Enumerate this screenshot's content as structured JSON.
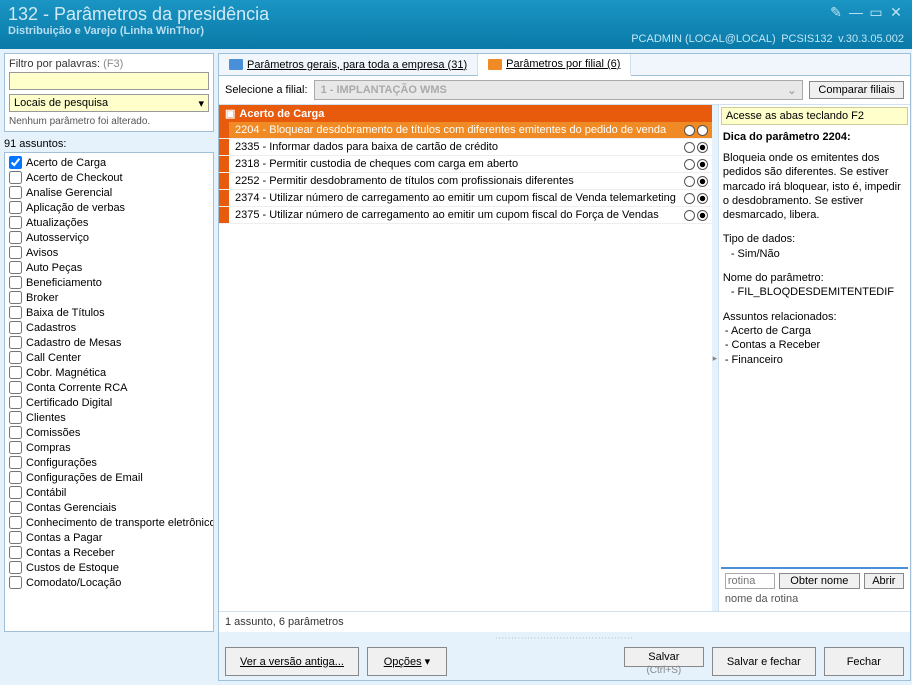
{
  "titlebar": {
    "title": "132 - Parâmetros da presidência",
    "subtitle": "Distribuição e Varejo (Linha WinThor)",
    "user": "PCADMIN (LOCAL@LOCAL)",
    "module": "PCSIS132",
    "version": "v.30.3.05.002"
  },
  "filter": {
    "label": "Filtro por palavras:",
    "hint": "(F3)",
    "search_value": "",
    "dropdown": "Locais de pesquisa",
    "no_change": "Nenhum parâmetro foi alterado."
  },
  "subjects": {
    "count_label": "91 assuntos:",
    "items": [
      {
        "label": "Acerto de Carga",
        "checked": true
      },
      {
        "label": "Acerto de Checkout",
        "checked": false
      },
      {
        "label": "Analise Gerencial",
        "checked": false
      },
      {
        "label": "Aplicação de verbas",
        "checked": false
      },
      {
        "label": "Atualizações",
        "checked": false
      },
      {
        "label": "Autosserviço",
        "checked": false
      },
      {
        "label": "Avisos",
        "checked": false
      },
      {
        "label": "Auto Peças",
        "checked": false
      },
      {
        "label": "Beneficiamento",
        "checked": false
      },
      {
        "label": "Broker",
        "checked": false
      },
      {
        "label": "Baixa de Títulos",
        "checked": false
      },
      {
        "label": "Cadastros",
        "checked": false
      },
      {
        "label": "Cadastro de Mesas",
        "checked": false
      },
      {
        "label": "Call Center",
        "checked": false
      },
      {
        "label": "Cobr. Magnética",
        "checked": false
      },
      {
        "label": "Conta Corrente RCA",
        "checked": false
      },
      {
        "label": "Certificado Digital",
        "checked": false
      },
      {
        "label": "Clientes",
        "checked": false
      },
      {
        "label": "Comissões",
        "checked": false
      },
      {
        "label": "Compras",
        "checked": false
      },
      {
        "label": "Configurações",
        "checked": false
      },
      {
        "label": "Configurações de Email",
        "checked": false
      },
      {
        "label": "Contábil",
        "checked": false
      },
      {
        "label": "Contas Gerenciais",
        "checked": false
      },
      {
        "label": "Conhecimento de transporte eletrônico",
        "checked": false
      },
      {
        "label": "Contas a Pagar",
        "checked": false
      },
      {
        "label": "Contas a Receber",
        "checked": false
      },
      {
        "label": "Custos de Estoque",
        "checked": false
      },
      {
        "label": "Comodato/Locação",
        "checked": false
      }
    ]
  },
  "tabs": {
    "general": "Parâmetros gerais, para toda a empresa  (31)",
    "branch": "Parâmetros por filial  (6)"
  },
  "filial": {
    "label": "Selecione a filial:",
    "value": "1  -  IMPLANTAÇÃO WMS",
    "compare_btn": "Comparar filiais"
  },
  "group_header": "Acerto de Carga",
  "params": [
    {
      "id": "2204",
      "text": "2204 - Bloquear desdobramento de títulos com diferentes emitentes do pedido de venda",
      "on": false,
      "selected": true
    },
    {
      "id": "2335",
      "text": "2335 - Informar dados para baixa de cartão de crédito",
      "on": true,
      "selected": false
    },
    {
      "id": "2318",
      "text": "2318 - Permitir custodia de cheques com carga em aberto",
      "on": true,
      "selected": false
    },
    {
      "id": "2252",
      "text": "2252 - Permitir desdobramento de títulos com profissionais diferentes",
      "on": true,
      "selected": false
    },
    {
      "id": "2374",
      "text": "2374 - Utilizar número de carregamento ao emitir um cupom fiscal de Venda telemarketing",
      "on": true,
      "selected": false
    },
    {
      "id": "2375",
      "text": "2375 - Utilizar número de carregamento ao emitir um cupom fiscal do Força de Vendas",
      "on": true,
      "selected": false
    }
  ],
  "footer_count": "1 assunto, 6 parâmetros",
  "tip": {
    "hint_bar": "Acesse as abas teclando F2",
    "title": "Dica do parâmetro 2204:",
    "body": "Bloqueia onde os emitentes dos pedidos são diferentes. Se estiver marcado irá bloquear, isto é, impedir o desdobramento. Se estiver desmarcado, libera.",
    "datatype_label": "Tipo de dados:",
    "datatype_value": "- Sim/Não",
    "paramname_label": "Nome do parâmetro:",
    "paramname_value": "- FIL_BLOQDESDEMITENTEDIF",
    "related_label": "Assuntos relacionados:",
    "related": [
      "- Acerto de Carga",
      "- Contas a Receber",
      "- Financeiro"
    ]
  },
  "routine": {
    "placeholder": "rotina",
    "get_name": "Obter nome",
    "open": "Abrir",
    "name_label": "nome da rotina"
  },
  "buttons": {
    "old_version": "Ver a versão antiga...",
    "options": "Opções",
    "save": "Salvar",
    "save_close": "Salvar e fechar",
    "close": "Fechar",
    "save_hint": "(Ctrl+S)"
  }
}
